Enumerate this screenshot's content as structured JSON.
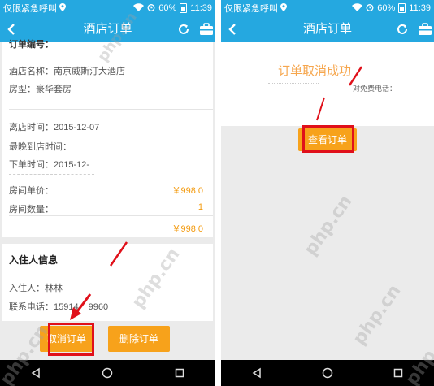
{
  "status_bar": {
    "carrier": "仅限紧急呼叫",
    "battery": "60%",
    "time": "11:39"
  },
  "left": {
    "nav_title": "酒店订单",
    "cut_off_header": "订单编号：",
    "hotel_name_label": "酒店名称：",
    "hotel_name": "南京威斯汀大酒店",
    "room_type_label": "房型：",
    "room_type": "豪华套房",
    "checkin_label": "离店时间：",
    "checkin_value": "2015-12-07",
    "latest_arrival_label": "最晚到店时间：",
    "order_time_label": "下单时间：",
    "order_time_value": "2015-12-",
    "unit_price_label": "房间单价：",
    "unit_price": "￥998.0",
    "room_count_label": "房间数量：",
    "room_count": "1",
    "total": "￥998.0",
    "guest_section_title": "入住人信息",
    "guest_label": "入住人：",
    "guest_name": "林林",
    "phone_label": "联系电话：",
    "phone_value": "15914",
    "phone_value_tail": "9960",
    "cancel_button": "取消订单",
    "delete_button": "删除订单"
  },
  "right": {
    "nav_title": "酒店订单",
    "success_text": "订单取消成功",
    "hotline_text": "对免费电话：",
    "view_order_button": "查看订单"
  },
  "watermark_text": "php.cn",
  "colors": {
    "bar_blue": "#25a8e0",
    "button_orange": "#f7a21b",
    "price_orange": "#f39a0e",
    "annotation_red": "#e0101a"
  },
  "icons": {
    "back": "chevron-left-icon",
    "refresh": "refresh-icon",
    "briefcase": "briefcase-icon",
    "nav_back": "triangle-back-icon",
    "home": "circle-home-icon",
    "recents": "square-recents-icon"
  }
}
